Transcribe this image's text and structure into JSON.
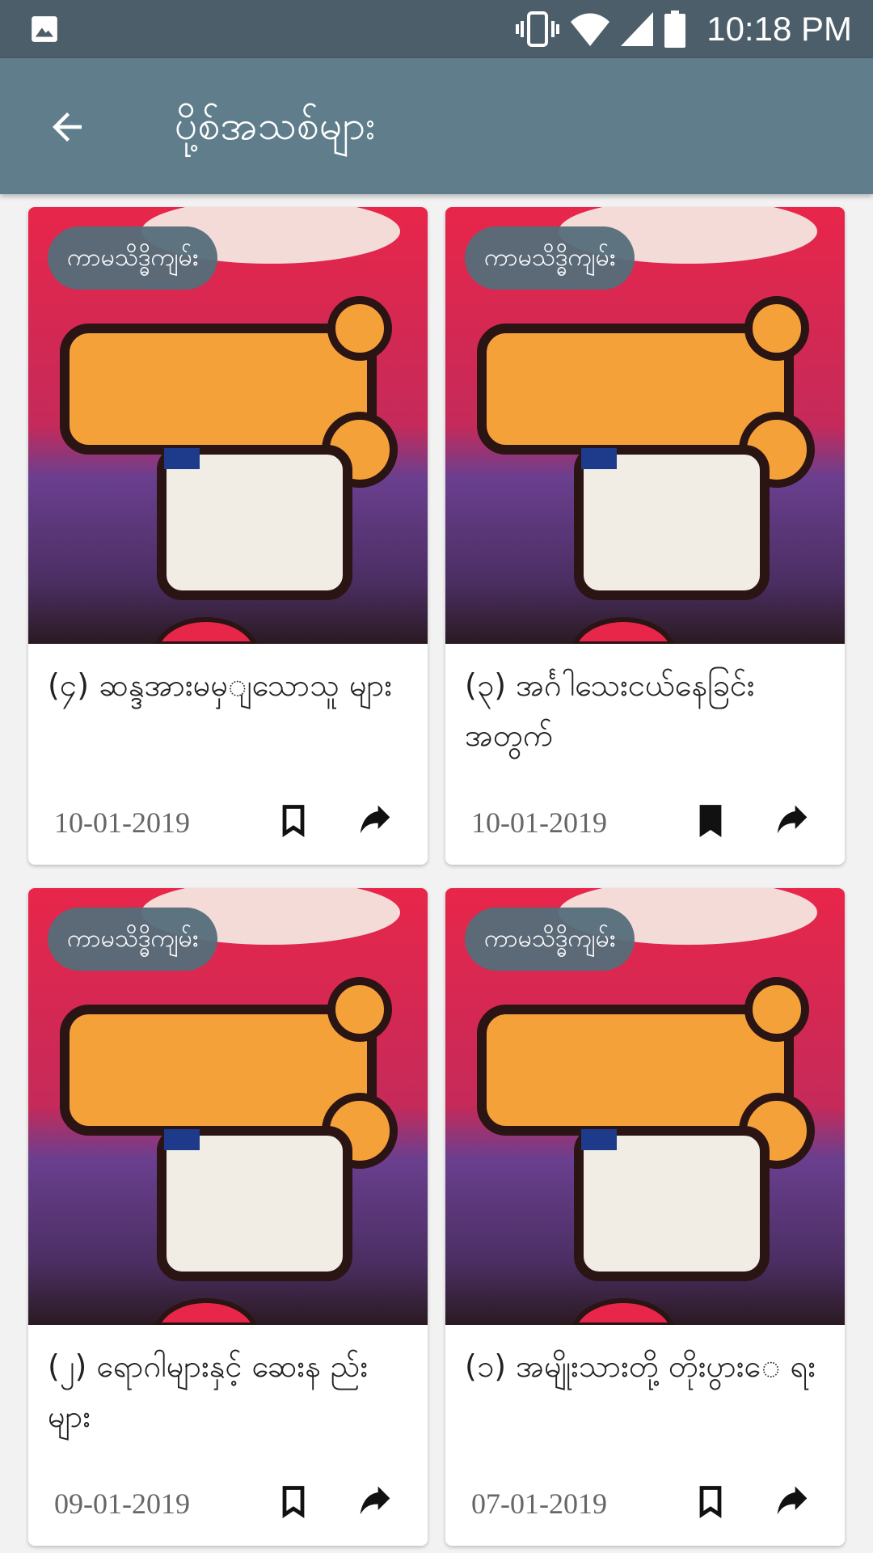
{
  "status_bar": {
    "time": "10:18 PM",
    "icons": [
      "image-icon",
      "vibrate-icon",
      "wifi-icon",
      "signal-icon",
      "battery-icon"
    ]
  },
  "app_bar": {
    "title": "ပို့စ်အသစ်များ",
    "back_icon": "arrow-back-icon"
  },
  "colors": {
    "app_bar": "#607d8b",
    "status_bar": "#4c5e69",
    "badge": "#546e7a"
  },
  "posts": [
    {
      "category": "ကာမသိဒ္ဓိကျမ်း",
      "title": "(၄) ဆန္ဒအားမမှျသောသူ များ",
      "date": "10-01-2019",
      "bookmarked": false
    },
    {
      "category": "ကာမသိဒ္ဓိကျမ်း",
      "title": "(၃) အင်္ဂါသေးငယ်နေခြင်း အတွက်",
      "date": "10-01-2019",
      "bookmarked": true
    },
    {
      "category": "ကာမသိဒ္ဓိကျမ်း",
      "title": "(၂) ရောဂါများနှင့် ဆေးန ည်းများ",
      "date": "09-01-2019",
      "bookmarked": false
    },
    {
      "category": "ကာမသိဒ္ဓိကျမ်း",
      "title": "(၁) အမျိုးသားတို့ တိုးပွားေ ရး",
      "date": "07-01-2019",
      "bookmarked": false
    }
  ]
}
